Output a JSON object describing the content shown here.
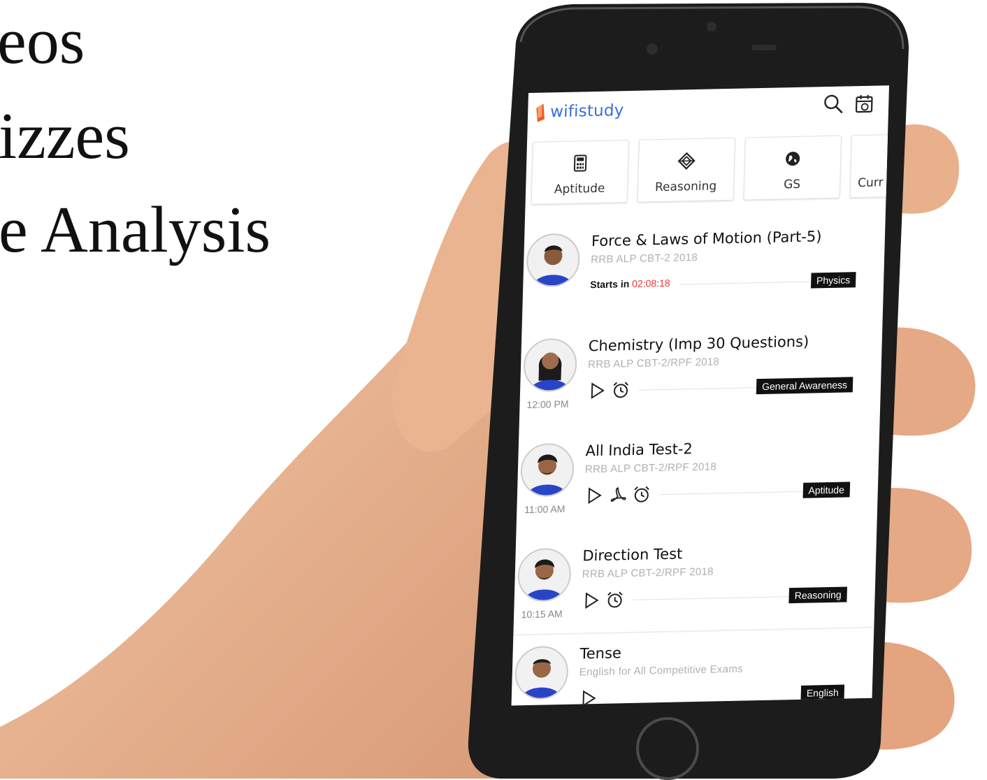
{
  "promo": {
    "line1": "eos",
    "line2": "izzes",
    "line3": "e Analysis"
  },
  "app": {
    "brand": "wifistudy",
    "brand_color": "#3a6fd6",
    "accent_orange": "#f05a28",
    "icons": {
      "search": "search-icon",
      "calendar": "calendar-icon"
    }
  },
  "categories": [
    {
      "label": "Aptitude",
      "icon": "calculator-icon"
    },
    {
      "label": "Reasoning",
      "icon": "cube-icon"
    },
    {
      "label": "GS",
      "icon": "globe-icon"
    },
    {
      "label": "Curr",
      "icon": ""
    }
  ],
  "classes": [
    {
      "title": "Force & Laws of Motion (Part-5)",
      "subtitle": "RRB ALP CBT-2 2018",
      "starts_label": "Starts in",
      "countdown": "02:08:18",
      "tag": "Physics",
      "time": ""
    },
    {
      "title": "Chemistry (Imp 30 Questions)",
      "subtitle": "RRB ALP CBT-2/RPF 2018",
      "tag": "General Awareness",
      "time": "12:00 PM"
    },
    {
      "title": "All India Test-2",
      "subtitle": "RRB ALP CBT-2/RPF 2018",
      "tag": "Aptitude",
      "time": "11:00 AM"
    },
    {
      "title": "Direction Test",
      "subtitle": "RRB ALP CBT-2/RPF 2018",
      "tag": "Reasoning",
      "time": "10:15 AM"
    },
    {
      "title": "Tense",
      "subtitle": "English for All Competitive Exams",
      "tag": "English",
      "time": ""
    }
  ],
  "colors": {
    "countdown": "#e53935",
    "tag_bg": "#111111",
    "phone_body": "#1c1c1c"
  }
}
